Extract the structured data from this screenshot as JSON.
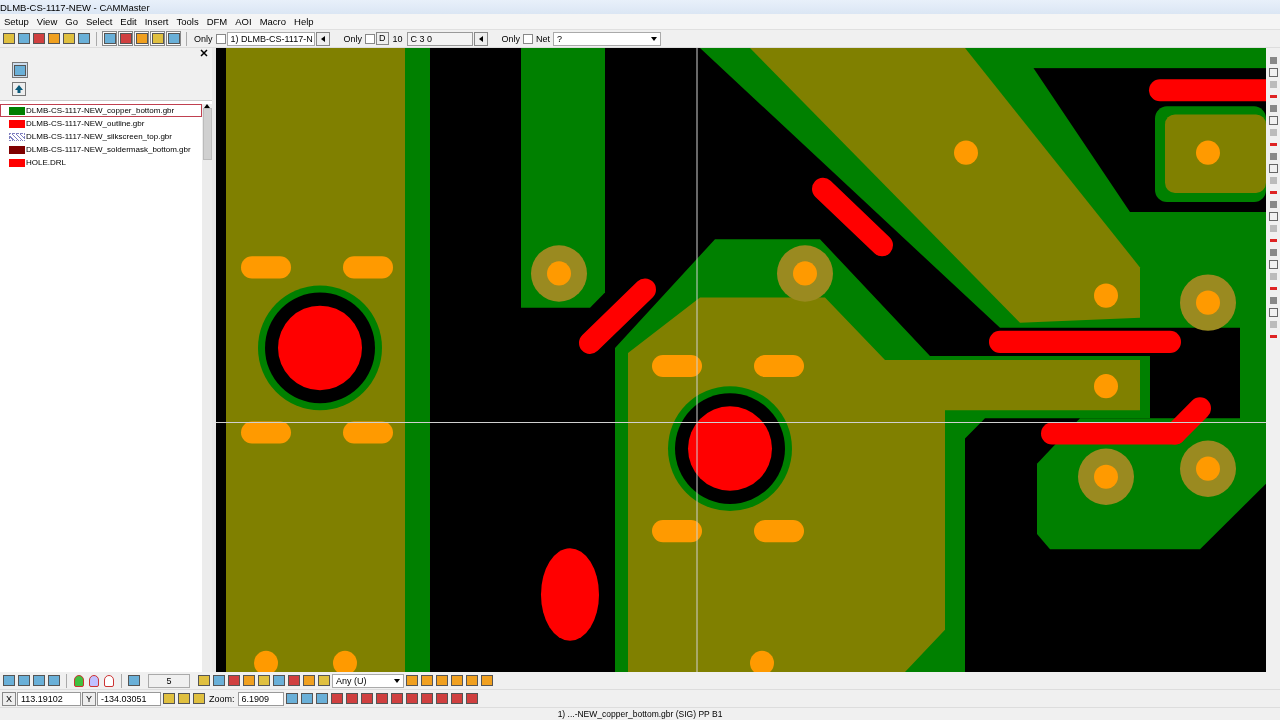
{
  "window": {
    "title": "DLMB-CS-1117-NEW - CAMMaster"
  },
  "menu": [
    "Setup",
    "View",
    "Go",
    "Select",
    "Edit",
    "Insert",
    "Tools",
    "DFM",
    "AOI",
    "Macro",
    "Help"
  ],
  "toolbar": {
    "layer_only_label": "Only",
    "layer_only_checked": false,
    "layer_select": "1) DLMB-CS-1117-N",
    "dcode_only_label": "Only",
    "dcode_only_checked": false,
    "dcode_button": "D",
    "dcode_value": "10",
    "dcode_info": "C 3  0",
    "net_only_label": "Only",
    "net_only_checked": false,
    "net_label": "Net",
    "net_select": "?"
  },
  "layers": [
    {
      "name": "DLMB-CS-1117-NEW_copper_bottom.gbr",
      "color": "#007f00",
      "kind": "solid",
      "selected": true
    },
    {
      "name": "DLMB-CS-1117-NEW_outline.gbr",
      "color": "#ff0000",
      "kind": "solid",
      "selected": false
    },
    {
      "name": "DLMB-CS-1117-NEW_silkscreen_top.gbr",
      "color": "#8080c0",
      "kind": "hatch",
      "selected": false
    },
    {
      "name": "DLMB-CS-1117-NEW_soldermask_bottom.gbr",
      "color": "#7f0000",
      "kind": "solid",
      "selected": false
    },
    {
      "name": "HOLE.DRL",
      "color": "#ff0000",
      "kind": "solid",
      "selected": false
    }
  ],
  "bottom": {
    "step": "5",
    "snap_select": "Any   (U)",
    "x_label": "X",
    "x_value": "113.19102",
    "y_label": "Y",
    "y_value": "-134.03051",
    "zoom_label": "Zoom:",
    "zoom_value": "6.1909"
  },
  "status_bar": "1) ...-NEW_copper_bottom.gbr (SIG) PP B1"
}
